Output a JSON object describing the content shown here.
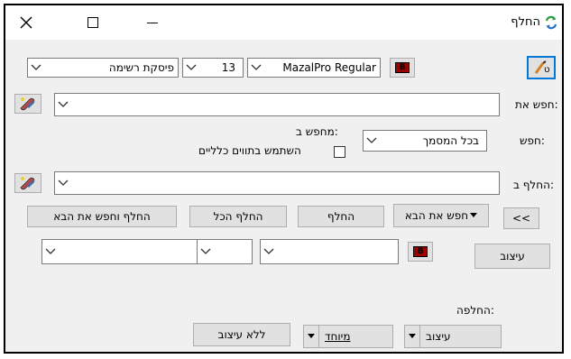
{
  "window": {
    "title": "החלף",
    "close_icon": "close-icon",
    "maximize_icon": "maximize-icon",
    "minimize_icon": "minimize-icon",
    "app_icon": "replace-icon"
  },
  "toolbar": {
    "font_name": "MazalPro Regular",
    "font_size": "13",
    "paragraph_style": "פיסקת רשימה",
    "color_button_letter": "B",
    "color_button_color": "#9b0000"
  },
  "labels": {
    "find_what": "חפש את:",
    "search": "חפש:",
    "search_in": "מחפש ב:",
    "use_wildcards": "השתמש בתווים כלליים",
    "replace_with": "החלף ב:",
    "replacement": "החלפה:"
  },
  "find": {
    "value": ""
  },
  "search_scope": {
    "value": "בכל המסמך"
  },
  "replace": {
    "value": ""
  },
  "buttons": {
    "expand": "<<",
    "find_next": "חפש את הבא",
    "replace": "החלף",
    "replace_all": "החלף הכל",
    "replace_find_next": "החלף וחפש את הבא",
    "format": "עיצוב",
    "format2": "עיצוב",
    "special": "מיוחד",
    "no_format": "ללא עיצוב"
  },
  "format_row": {
    "color_button_letter": "B",
    "color_button_color": "#9b0000"
  }
}
